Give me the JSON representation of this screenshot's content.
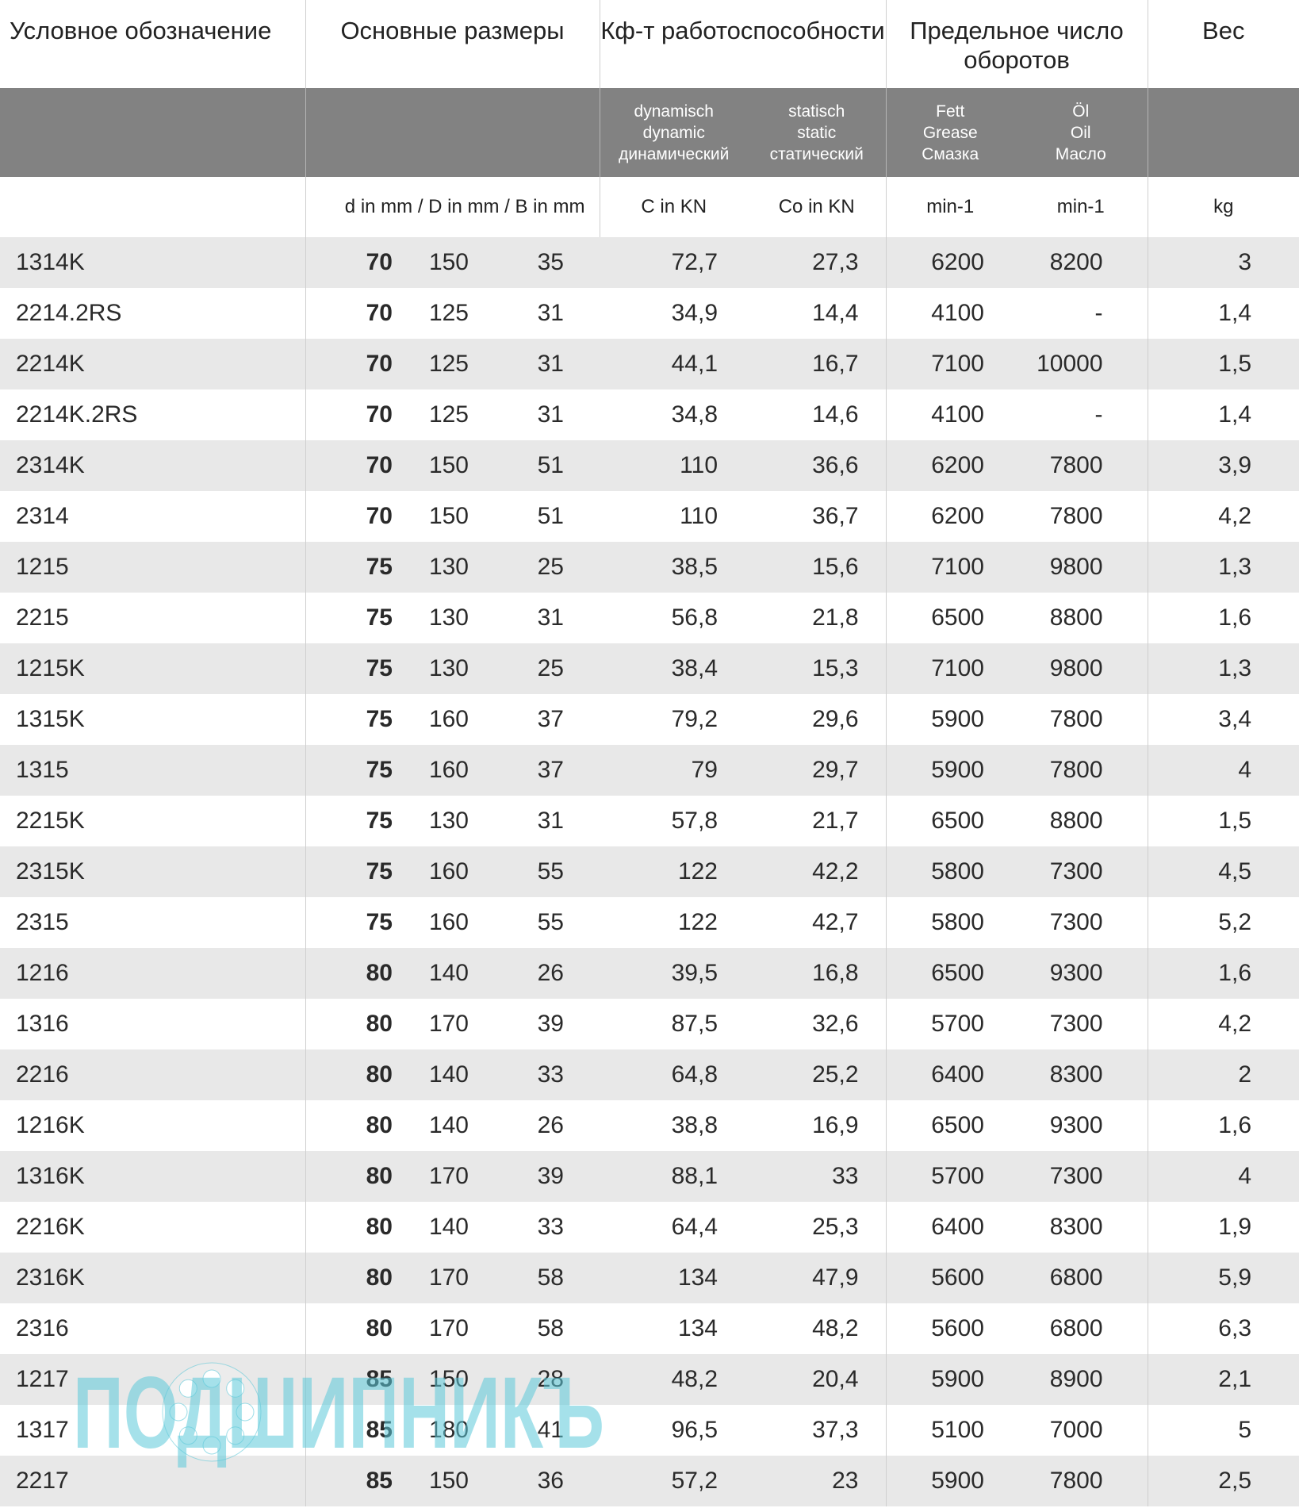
{
  "header": {
    "designation": "Условное обозначение",
    "dimensions": "Основные размеры",
    "load_rating": "Кф-т работоспособности",
    "speed_limit": "Предельное число оборотов",
    "weight": "Вес"
  },
  "subheader": {
    "dynamic": [
      "dynamisch",
      "dynamic",
      "динамический"
    ],
    "static": [
      "statisch",
      "static",
      "статический"
    ],
    "grease": [
      "Fett",
      "Grease",
      "Смазка"
    ],
    "oil": [
      "Öl",
      "Oil",
      "Масло"
    ]
  },
  "units": {
    "dims": "d in mm / D in mm / B in mm",
    "c": "C in KN",
    "co": "Co in KN",
    "grease": "min-1",
    "oil": "min-1",
    "weight": "kg"
  },
  "rows": [
    [
      "1314K",
      "70",
      "150",
      "35",
      "72,7",
      "27,3",
      "6200",
      "8200",
      "3"
    ],
    [
      "2214.2RS",
      "70",
      "125",
      "31",
      "34,9",
      "14,4",
      "4100",
      "-",
      "1,4"
    ],
    [
      "2214K",
      "70",
      "125",
      "31",
      "44,1",
      "16,7",
      "7100",
      "10000",
      "1,5"
    ],
    [
      "2214K.2RS",
      "70",
      "125",
      "31",
      "34,8",
      "14,6",
      "4100",
      "-",
      "1,4"
    ],
    [
      "2314K",
      "70",
      "150",
      "51",
      "110",
      "36,6",
      "6200",
      "7800",
      "3,9"
    ],
    [
      "2314",
      "70",
      "150",
      "51",
      "110",
      "36,7",
      "6200",
      "7800",
      "4,2"
    ],
    [
      "1215",
      "75",
      "130",
      "25",
      "38,5",
      "15,6",
      "7100",
      "9800",
      "1,3"
    ],
    [
      "2215",
      "75",
      "130",
      "31",
      "56,8",
      "21,8",
      "6500",
      "8800",
      "1,6"
    ],
    [
      "1215K",
      "75",
      "130",
      "25",
      "38,4",
      "15,3",
      "7100",
      "9800",
      "1,3"
    ],
    [
      "1315K",
      "75",
      "160",
      "37",
      "79,2",
      "29,6",
      "5900",
      "7800",
      "3,4"
    ],
    [
      "1315",
      "75",
      "160",
      "37",
      "79",
      "29,7",
      "5900",
      "7800",
      "4"
    ],
    [
      "2215K",
      "75",
      "130",
      "31",
      "57,8",
      "21,7",
      "6500",
      "8800",
      "1,5"
    ],
    [
      "2315K",
      "75",
      "160",
      "55",
      "122",
      "42,2",
      "5800",
      "7300",
      "4,5"
    ],
    [
      "2315",
      "75",
      "160",
      "55",
      "122",
      "42,7",
      "5800",
      "7300",
      "5,2"
    ],
    [
      "1216",
      "80",
      "140",
      "26",
      "39,5",
      "16,8",
      "6500",
      "9300",
      "1,6"
    ],
    [
      "1316",
      "80",
      "170",
      "39",
      "87,5",
      "32,6",
      "5700",
      "7300",
      "4,2"
    ],
    [
      "2216",
      "80",
      "140",
      "33",
      "64,8",
      "25,2",
      "6400",
      "8300",
      "2"
    ],
    [
      "1216K",
      "80",
      "140",
      "26",
      "38,8",
      "16,9",
      "6500",
      "9300",
      "1,6"
    ],
    [
      "1316K",
      "80",
      "170",
      "39",
      "88,1",
      "33",
      "5700",
      "7300",
      "4"
    ],
    [
      "2216K",
      "80",
      "140",
      "33",
      "64,4",
      "25,3",
      "6400",
      "8300",
      "1,9"
    ],
    [
      "2316K",
      "80",
      "170",
      "58",
      "134",
      "47,9",
      "5600",
      "6800",
      "5,9"
    ],
    [
      "2316",
      "80",
      "170",
      "58",
      "134",
      "48,2",
      "5600",
      "6800",
      "6,3"
    ],
    [
      "1217",
      "85",
      "150",
      "28",
      "48,2",
      "20,4",
      "5900",
      "8900",
      "2,1"
    ],
    [
      "1317",
      "85",
      "180",
      "41",
      "96,5",
      "37,3",
      "5100",
      "7000",
      "5"
    ],
    [
      "2217",
      "85",
      "150",
      "36",
      "57,2",
      "23",
      "5900",
      "7800",
      "2,5"
    ]
  ],
  "watermark": {
    "text": "ПОДШИПНИКЪ",
    "color": "#5bc8d8"
  },
  "colors": {
    "header_bg": "#828282",
    "row_shade": "#e8e8e8"
  }
}
